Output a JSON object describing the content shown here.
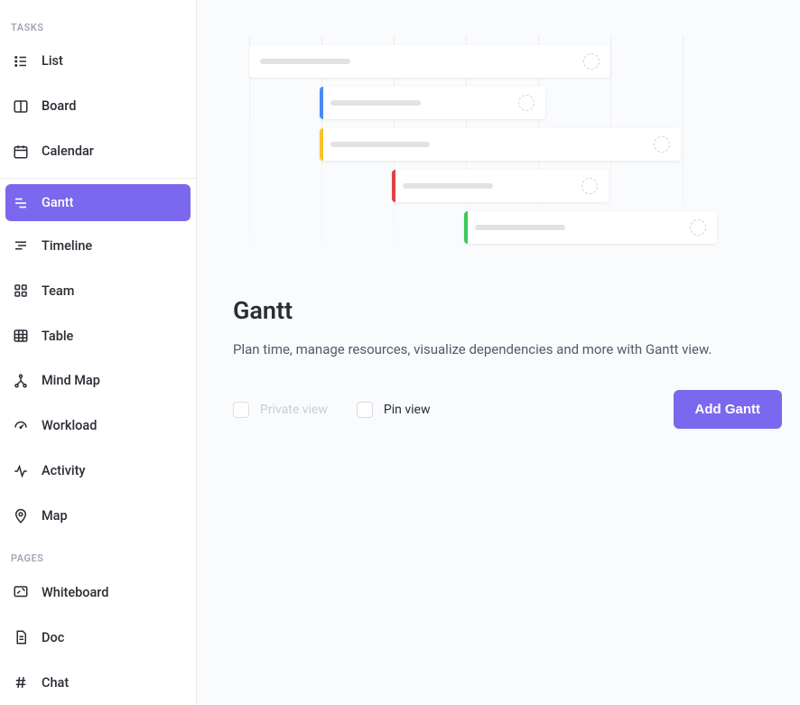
{
  "sidebar": {
    "sections": {
      "tasks_label": "TASKS",
      "pages_label": "PAGES"
    },
    "items": {
      "list": "List",
      "board": "Board",
      "calendar": "Calendar",
      "gantt": "Gantt",
      "timeline": "Timeline",
      "team": "Team",
      "table": "Table",
      "mind_map": "Mind Map",
      "workload": "Workload",
      "activity": "Activity",
      "map": "Map",
      "whiteboard": "Whiteboard",
      "doc": "Doc",
      "chat": "Chat"
    },
    "active": "gantt"
  },
  "main": {
    "title": "Gantt",
    "description": "Plan time, manage resources, visualize dependencies and more with Gantt view.",
    "private_view_label": "Private view",
    "private_view_enabled": false,
    "pin_view_label": "Pin view",
    "add_button_label": "Add Gantt"
  },
  "colors": {
    "accent": "#7b68ee",
    "bar_blue": "#4a8af4",
    "bar_yellow": "#f9c22a",
    "bar_red": "#e14246",
    "bar_green": "#3ccb5a"
  }
}
